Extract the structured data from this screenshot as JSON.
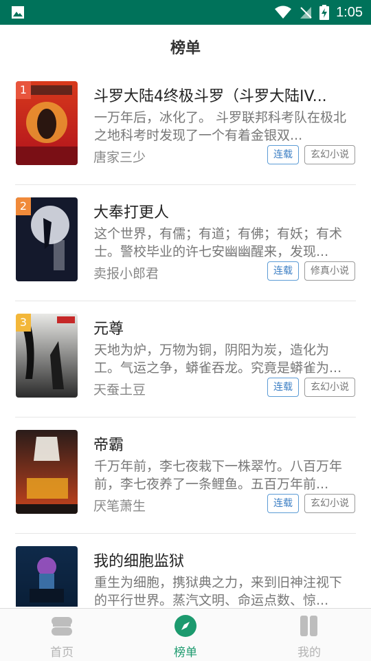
{
  "status_bar": {
    "time": "1:05"
  },
  "header": {
    "title": "榜单"
  },
  "books": [
    {
      "rank": "1",
      "title": "斗罗大陆4终极斗罗（斗罗大陆IV...",
      "desc": "一万年后，冰化了。        斗罗联邦科考队在极北之地科考时发现了一个有着金银双...",
      "author": "唐家三少",
      "status": "连载",
      "genre": "玄幻小说",
      "rank_color": "#e8553d"
    },
    {
      "rank": "2",
      "title": "大奉打更人",
      "desc": "这个世界，有儒；有道；有佛；有妖；有术士。警校毕业的许七安幽幽醒来，发现...",
      "author": "卖报小郎君",
      "status": "连载",
      "genre": "修真小说",
      "rank_color": "#f08a3a"
    },
    {
      "rank": "3",
      "title": "元尊",
      "desc": "天地为炉，万物为铜，阴阳为炭，造化为工。气运之争，蟒雀吞龙。究竟是蟒雀为...",
      "author": "天蚕土豆",
      "status": "连载",
      "genre": "玄幻小说",
      "rank_color": "#f3b73a"
    },
    {
      "rank": "",
      "title": "帝霸",
      "desc": "千万年前，李七夜栽下一株翠竹。八百万年前，李七夜养了一条鲤鱼。五百万年前...",
      "author": "厌笔萧生",
      "status": "连载",
      "genre": "玄幻小说",
      "rank_color": ""
    },
    {
      "rank": "",
      "title": "我的细胞监狱",
      "desc": "重生为细胞，携狱典之力，来到旧神注视下的平行世界。蒸汽文明、命运点数、惊...",
      "author": "",
      "status": "",
      "genre": "",
      "rank_color": ""
    }
  ],
  "tabs": [
    {
      "label": "首页",
      "icon": "home-icon"
    },
    {
      "label": "榜单",
      "icon": "compass-icon",
      "active": true
    },
    {
      "label": "我的",
      "icon": "bookshelf-icon"
    }
  ],
  "colors": {
    "status_bar": "#00725a",
    "accent": "#1c9a6e"
  }
}
